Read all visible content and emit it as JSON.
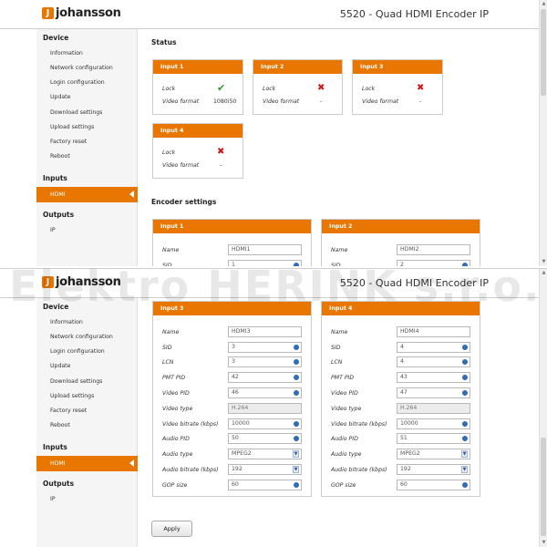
{
  "header": {
    "logo_letter": "J",
    "logo_text": "johansson",
    "title": "5520 - Quad HDMI Encoder IP"
  },
  "sidebar": {
    "device_heading": "Device",
    "device_items": [
      "Information",
      "Network configuration",
      "Login configuration",
      "Update",
      "Download settings",
      "Upload settings",
      "Factory reset",
      "Reboot"
    ],
    "inputs_heading": "Inputs",
    "inputs_items": [
      "HDMI"
    ],
    "outputs_heading": "Outputs",
    "outputs_items": [
      "IP"
    ]
  },
  "status": {
    "heading": "Status",
    "lock_label": "Lock",
    "format_label": "Video format",
    "inputs": [
      {
        "title": "Input 1",
        "lock": "ok",
        "video_format": "1080i50"
      },
      {
        "title": "Input 2",
        "lock": "fail",
        "video_format": "-"
      },
      {
        "title": "Input 3",
        "lock": "fail",
        "video_format": "-"
      },
      {
        "title": "Input 4",
        "lock": "fail",
        "video_format": "-"
      }
    ]
  },
  "encoder": {
    "heading": "Encoder settings",
    "labels": {
      "name": "Name",
      "sid": "SID",
      "lcn": "LCN",
      "pmt_pid": "PMT PID",
      "video_pid": "Video PID",
      "video_type": "Video type",
      "video_bitrate": "Video bitrate (kbps)",
      "audio_pid": "Audio PID",
      "audio_type": "Audio type",
      "audio_bitrate": "Audio bitrate (kbps)",
      "gop_size": "GOP size"
    },
    "inputs": [
      {
        "title": "Input 1",
        "name": "HDMI1",
        "sid": "1"
      },
      {
        "title": "Input 2",
        "name": "HDMI2",
        "sid": "2"
      },
      {
        "title": "Input 3",
        "name": "HDMI3",
        "sid": "3",
        "lcn": "3",
        "pmt_pid": "42",
        "video_pid": "46",
        "video_type": "H.264",
        "video_bitrate": "10000",
        "audio_pid": "50",
        "audio_type": "MPEG2",
        "audio_bitrate": "192",
        "gop_size": "60"
      },
      {
        "title": "Input 4",
        "name": "HDMI4",
        "sid": "4",
        "lcn": "4",
        "pmt_pid": "43",
        "video_pid": "47",
        "video_type": "H.264",
        "video_bitrate": "10000",
        "audio_pid": "51",
        "audio_type": "MPEG2",
        "audio_bitrate": "192",
        "gop_size": "60"
      }
    ],
    "apply_label": "Apply"
  },
  "watermark": "Elektro HERINK s.r.o.",
  "colors": {
    "accent": "#e87600",
    "ok": "#2c9a2c",
    "fail": "#d01818"
  },
  "icons": {
    "ok": "check-icon",
    "fail": "cross-icon"
  }
}
